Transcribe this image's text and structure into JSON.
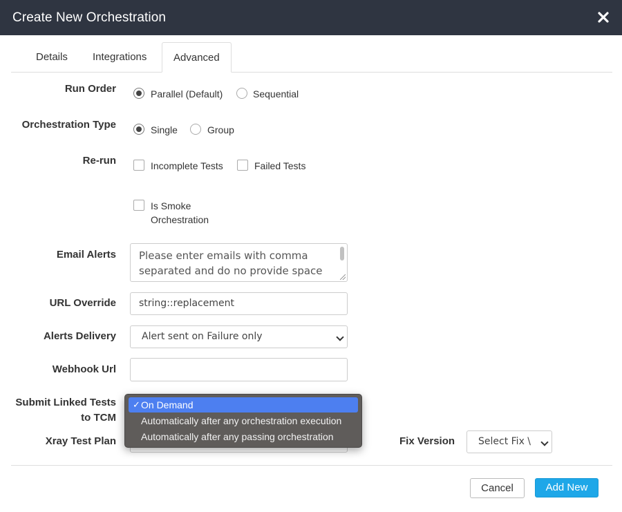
{
  "dialog": {
    "title": "Create New Orchestration"
  },
  "tabs": [
    {
      "label": "Details"
    },
    {
      "label": "Integrations"
    },
    {
      "label": "Advanced"
    }
  ],
  "form": {
    "run_order": {
      "label": "Run Order",
      "options": [
        "Parallel (Default)",
        "Sequential"
      ],
      "selected": "Parallel (Default)"
    },
    "orchestration_type": {
      "label": "Orchestration Type",
      "options": [
        "Single",
        "Group"
      ],
      "selected": "Single"
    },
    "rerun": {
      "label": "Re-run",
      "options": [
        "Incomplete Tests",
        "Failed Tests"
      ]
    },
    "smoke": {
      "line1": "Is Smoke",
      "line2": "Orchestration"
    },
    "email_alerts": {
      "label": "Email Alerts",
      "placeholder": "Please enter emails with comma separated and do no provide space"
    },
    "url_override": {
      "label": "URL Override",
      "value": "string::replacement"
    },
    "alerts_delivery": {
      "label": "Alerts Delivery",
      "value": "Alert sent on Failure only"
    },
    "webhook_url": {
      "label": "Webhook Url",
      "value": ""
    },
    "submit_linked": {
      "label_line1": "Submit Linked Tests",
      "label_line2": "to TCM"
    },
    "xray_test_plan": {
      "label": "Xray Test Plan"
    },
    "fix_version": {
      "label": "Fix Version",
      "value": "Select Fix \\"
    }
  },
  "dropdown": {
    "check": "✓",
    "options": [
      "On Demand",
      "Automatically after any orchestration execution",
      "Automatically after any passing orchestration"
    ],
    "selected_index": 0
  },
  "footer": {
    "cancel_label": "Cancel",
    "add_label": "Add New"
  }
}
